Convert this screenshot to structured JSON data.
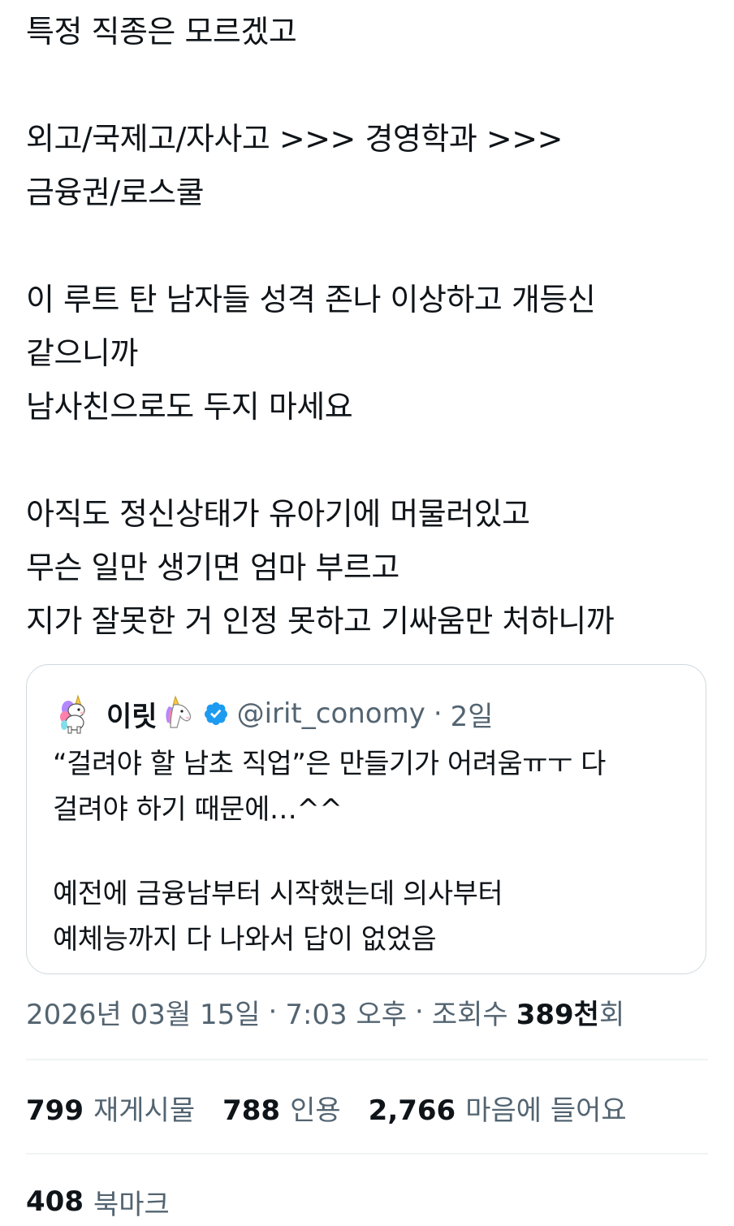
{
  "tweet": {
    "lines": [
      "특정 직종은 모르겠고",
      "",
      "외고/국제고/자사고 >>> 경영학과 >>>",
      "금융권/로스쿨",
      "",
      "이 루트 탄 남자들 성격 존나 이상하고 개등신",
      "같으니까",
      "남사친으로도 두지 마세요",
      "",
      "아직도 정신상태가 유아기에 머물러있고",
      "무슨 일만 생기면 엄마 부르고",
      "지가 잘못한 거 인정 못하고 기싸움만 처하니까"
    ]
  },
  "quote": {
    "avatar_icon": "unicorn-avatar-icon",
    "name": "이릿",
    "name_emoji": "unicorn-emoji-icon",
    "verified_icon": "verified-badge-icon",
    "verified_color": "#1d9bf0",
    "handle": "@irit_conomy",
    "dot": "·",
    "time": "2일",
    "lines": [
      "“걸려야 할 남초 직업”은 만들기가 어려움ㅠㅜ 다",
      "걸려야 하기 때문에…^^",
      "",
      "예전에 금융남부터 시작했는데 의사부터",
      "예체능까지 다 나와서 답이 없었음"
    ]
  },
  "meta": {
    "date": "2026년 03월 15일",
    "sep1": "·",
    "time": "7:03 오후",
    "sep2": "·",
    "views_label": "조회수",
    "views_count": "389천",
    "views_suffix": "회"
  },
  "stats": {
    "retweets_count": "799",
    "retweets_label": "재게시물",
    "quotes_count": "788",
    "quotes_label": "인용",
    "likes_count": "2,766",
    "likes_label": "마음에 들어요",
    "bookmarks_count": "408",
    "bookmarks_label": "북마크"
  },
  "colors": {
    "text": "#0f1419",
    "secondary": "#536471",
    "border": "#cfd9de",
    "divider": "#eff3f4",
    "verified": "#1d9bf0"
  }
}
